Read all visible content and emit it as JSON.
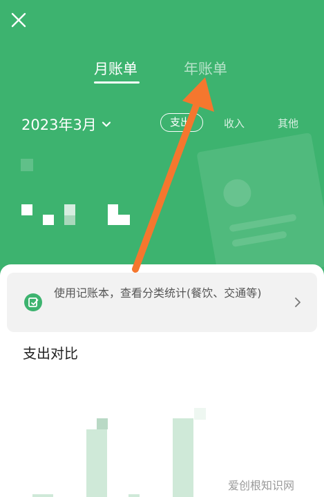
{
  "header": {
    "tabs": [
      {
        "label": "月账单",
        "active": true
      },
      {
        "label": "年账单",
        "active": false
      }
    ],
    "date_label": "2023年3月",
    "filters": [
      {
        "label": "支出",
        "selected": true
      },
      {
        "label": "收入",
        "selected": false
      },
      {
        "label": "其他",
        "selected": false
      }
    ]
  },
  "tip": {
    "text": "使用记账本，查看分类统计(餐饮、交通等)"
  },
  "comparison": {
    "title": "支出对比"
  },
  "watermark": "爱创根知识网",
  "icons": {
    "close": "close-icon",
    "date_dropdown": "chevron-down-icon",
    "tip_icon": "ledger-edit-icon",
    "tip_arrow": "chevron-right-icon"
  },
  "colors": {
    "brand_green": "#3db36f",
    "annotation_arrow": "#f5772e",
    "bar_light_green": "#cfe9d8"
  }
}
